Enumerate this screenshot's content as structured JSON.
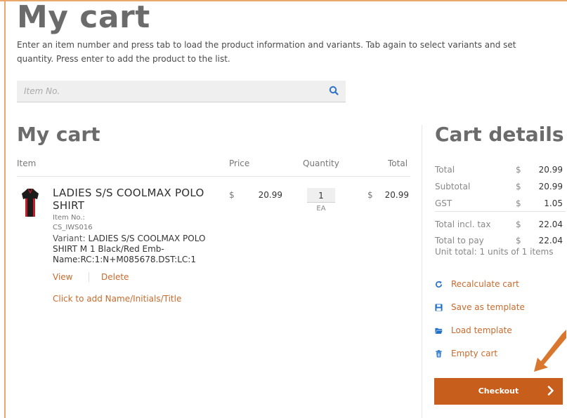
{
  "page": {
    "title": "My cart",
    "intro": "Enter an item number and press tab to load the product information and variants. Tab again to select variants and set quantity. Press enter to add the product to the list."
  },
  "search": {
    "placeholder": "Item No."
  },
  "cart": {
    "title": "My cart",
    "columns": {
      "item": "Item",
      "price": "Price",
      "quantity": "Quantity",
      "total": "Total"
    },
    "items": [
      {
        "name": "LADIES S/S COOLMAX POLO SHIRT",
        "item_no_label": "Item No.:",
        "item_no": "CS_IWS016",
        "variant_label": "Variant:",
        "variant_value": "LADIES S/S COOLMAX POLO SHIRT M 1 Black/Red Emb-Name:RC:1:N+M085678.DST:LC:1",
        "currency": "$",
        "price": "20.99",
        "quantity": "1",
        "uom": "EA",
        "total": "20.99",
        "view_label": "View",
        "delete_label": "Delete",
        "add_name_label": "Click to add Name/Initials/Title"
      }
    ]
  },
  "details": {
    "title": "Cart details",
    "rows": [
      {
        "label": "Total",
        "currency": "$",
        "value": "20.99"
      },
      {
        "label": "Subtotal",
        "currency": "$",
        "value": "20.99"
      },
      {
        "label": "GST",
        "currency": "$",
        "value": "1.05"
      },
      {
        "label": "Total incl. tax",
        "currency": "$",
        "value": "22.04"
      },
      {
        "label": "Total to pay",
        "currency": "$",
        "value": "22.04"
      }
    ],
    "unit_total": "Unit total: 1 units of 1 items",
    "actions": {
      "recalculate": "Recalculate cart",
      "save_template": "Save as template",
      "load_template": "Load template",
      "empty_cart": "Empty cart"
    },
    "checkout_label": "Checkout"
  },
  "colors": {
    "accent": "#c75e1c",
    "link": "#c86a2c",
    "frame": "#e9a76b"
  },
  "icons": {
    "search": "search-icon",
    "recalculate": "refresh-icon",
    "save": "floppy-disk-icon",
    "load": "folder-open-icon",
    "empty": "trash-icon",
    "checkout": "chevron-right-icon"
  }
}
